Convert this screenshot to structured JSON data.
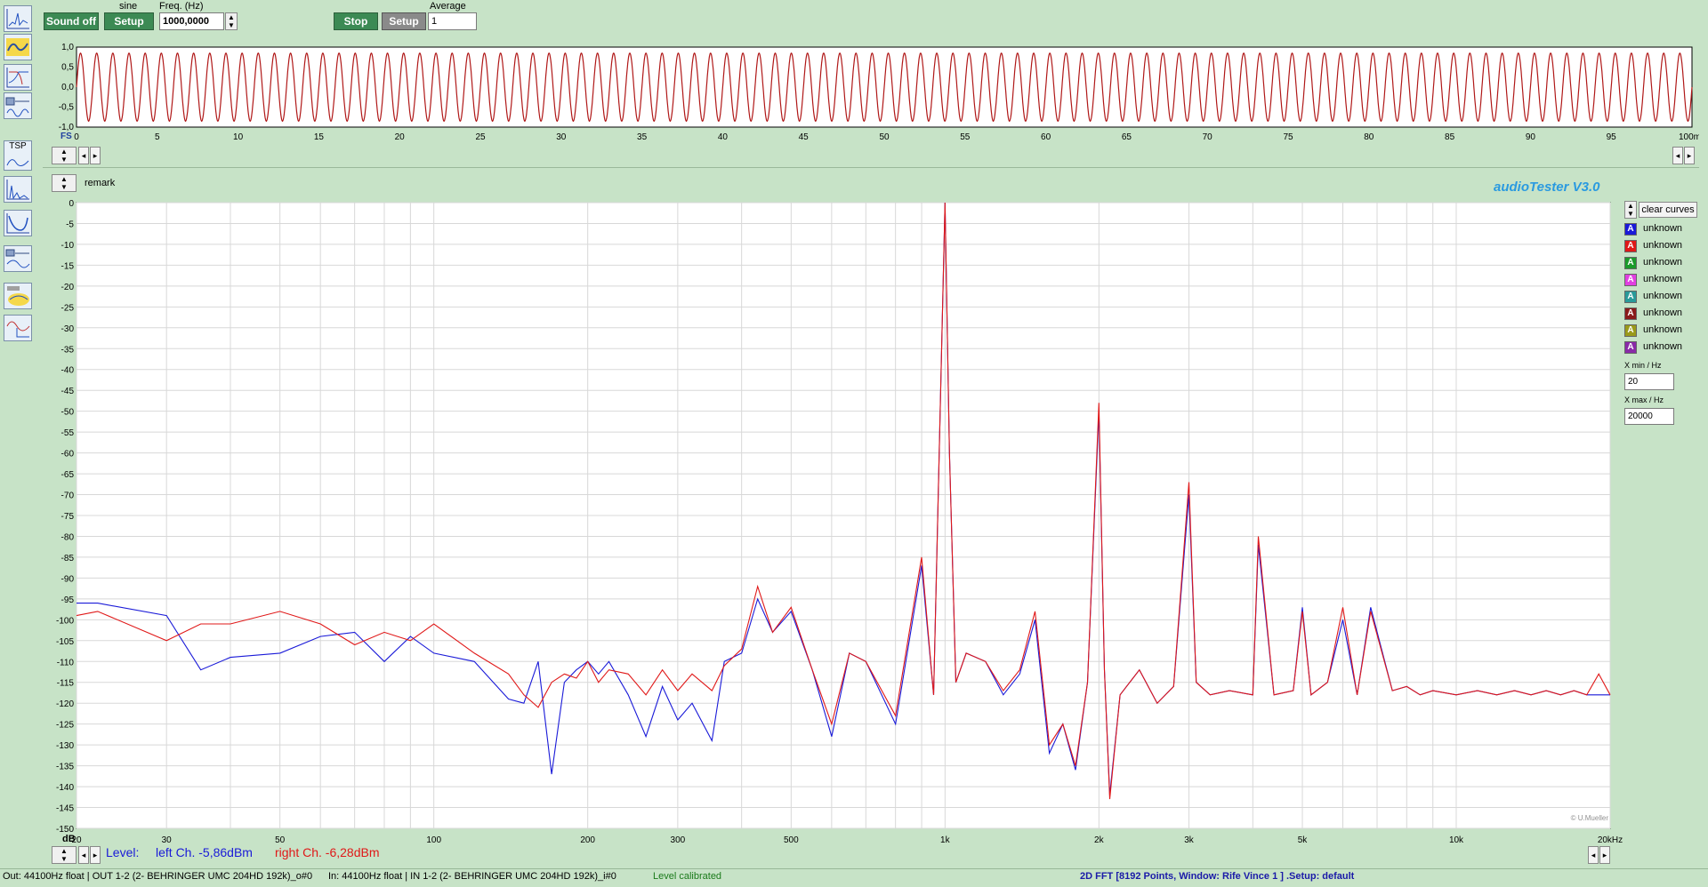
{
  "toolbar": {
    "sound_button": "Sound off",
    "signal_type": "sine",
    "setup_button": "Setup",
    "freq_label": "Freq. (Hz)",
    "freq_value": "1000,0000",
    "stop_button": "Stop",
    "setup2_button": "Setup",
    "average_label": "Average",
    "average_value": "1"
  },
  "sidebar": {
    "tsp_label": "TSP"
  },
  "scope": {
    "y_ticks": [
      "1,0",
      "0,5",
      "0,0",
      "-0,5",
      "-1,0"
    ],
    "fs_label": "FS",
    "x_ticks": [
      "0",
      "5",
      "10",
      "15",
      "20",
      "25",
      "30",
      "35",
      "40",
      "45",
      "50",
      "55",
      "60",
      "65",
      "70",
      "75",
      "80",
      "85",
      "90",
      "95",
      "100ms"
    ],
    "cycles": 100,
    "amplitude": 0.85
  },
  "fft": {
    "remark_label": "remark",
    "app_title": "audioTester  V3.0",
    "copyright": "© U.Mueller",
    "db_label": "dB",
    "y_ticks": [
      "0",
      "-5",
      "-10",
      "-15",
      "-20",
      "-25",
      "-30",
      "-35",
      "-40",
      "-45",
      "-50",
      "-55",
      "-60",
      "-65",
      "-70",
      "-75",
      "-80",
      "-85",
      "-90",
      "-95",
      "-100",
      "-105",
      "-110",
      "-115",
      "-120",
      "-125",
      "-130",
      "-135",
      "-140",
      "-145",
      "-150"
    ],
    "x_ticks": [
      "20",
      "30",
      "50",
      "100",
      "200",
      "300",
      "500",
      "1k",
      "2k",
      "3k",
      "5k",
      "10k",
      "20kHz"
    ],
    "level_label": "Level:",
    "left_level": "left Ch. -5,86dBm",
    "right_level": "right Ch. -6,28dBm",
    "clear_curves": "clear curves",
    "curves": [
      {
        "label": "unknown",
        "color": "#1a1ad8"
      },
      {
        "label": "unknown",
        "color": "#e01818"
      },
      {
        "label": "unknown",
        "color": "#1a9a2a"
      },
      {
        "label": "unknown",
        "color": "#e040e0"
      },
      {
        "label": "unknown",
        "color": "#2a9a9a"
      },
      {
        "label": "unknown",
        "color": "#8a1a1a"
      },
      {
        "label": "unknown",
        "color": "#9a9a1a"
      },
      {
        "label": "unknown",
        "color": "#8a2aa8"
      }
    ],
    "xmin_label": "X min / Hz",
    "xmin_value": "20",
    "xmax_label": "X max / Hz",
    "xmax_value": "20000"
  },
  "chart_data": {
    "type": "line",
    "title": "audioTester  V3.0",
    "xlabel": "",
    "ylabel": "dB",
    "xscale": "log",
    "xlim": [
      20,
      20000
    ],
    "ylim": [
      -150,
      0
    ],
    "grid": true,
    "legend": "right",
    "series": [
      {
        "name": "left Ch. -5,86dBm",
        "color": "#1a1ad8",
        "x": [
          20,
          22,
          30,
          35,
          40,
          50,
          60,
          70,
          80,
          90,
          100,
          120,
          140,
          150,
          160,
          170,
          180,
          190,
          200,
          210,
          220,
          240,
          260,
          280,
          300,
          320,
          350,
          370,
          400,
          430,
          460,
          500,
          550,
          600,
          650,
          700,
          800,
          900,
          950,
          1000,
          1020,
          1050,
          1100,
          1200,
          1300,
          1400,
          1500,
          1600,
          1700,
          1800,
          1900,
          2000,
          2050,
          2100,
          2200,
          2400,
          2600,
          2800,
          3000,
          3100,
          3300,
          3600,
          4000,
          4100,
          4400,
          4800,
          5000,
          5200,
          5600,
          6000,
          6400,
          6800,
          7500,
          8000,
          8500,
          9000,
          10000,
          11000,
          12000,
          13000,
          14000,
          15000,
          16000,
          17000,
          18000,
          19000,
          20000
        ],
        "y": [
          -96,
          -96,
          -99,
          -112,
          -109,
          -108,
          -104,
          -103,
          -110,
          -104,
          -108,
          -110,
          -119,
          -120,
          -110,
          -137,
          -115,
          -112,
          -110,
          -113,
          -110,
          -118,
          -128,
          -116,
          -124,
          -120,
          -129,
          -110,
          -108,
          -95,
          -103,
          -98,
          -112,
          -128,
          -108,
          -110,
          -125,
          -87,
          -118,
          0,
          -60,
          -115,
          -108,
          -110,
          -118,
          -113,
          -100,
          -132,
          -125,
          -136,
          -115,
          -50,
          -112,
          -142,
          -118,
          -112,
          -120,
          -116,
          -70,
          -115,
          -118,
          -117,
          -118,
          -82,
          -118,
          -117,
          -97,
          -118,
          -115,
          -100,
          -118,
          -97,
          -117,
          -116,
          -118,
          -117,
          -118,
          -117,
          -118,
          -117,
          -118,
          -117,
          -118,
          -117,
          -118,
          -118,
          -118
        ]
      },
      {
        "name": "right Ch. -6,28dBm",
        "color": "#e01818",
        "x": [
          20,
          22,
          30,
          35,
          40,
          50,
          60,
          70,
          80,
          90,
          100,
          120,
          140,
          150,
          160,
          170,
          180,
          190,
          200,
          210,
          220,
          240,
          260,
          280,
          300,
          320,
          350,
          370,
          400,
          430,
          460,
          500,
          550,
          600,
          650,
          700,
          800,
          900,
          950,
          1000,
          1020,
          1050,
          1100,
          1200,
          1300,
          1400,
          1500,
          1600,
          1700,
          1800,
          1900,
          2000,
          2050,
          2100,
          2200,
          2400,
          2600,
          2800,
          3000,
          3100,
          3300,
          3600,
          4000,
          4100,
          4400,
          4800,
          5000,
          5200,
          5600,
          6000,
          6400,
          6800,
          7500,
          8000,
          8500,
          9000,
          10000,
          11000,
          12000,
          13000,
          14000,
          15000,
          16000,
          17000,
          18000,
          19000,
          20000
        ],
        "y": [
          -99,
          -98,
          -105,
          -101,
          -101,
          -98,
          -101,
          -106,
          -103,
          -105,
          -101,
          -108,
          -113,
          -118,
          -121,
          -115,
          -113,
          -114,
          -110,
          -115,
          -112,
          -113,
          -118,
          -112,
          -117,
          -113,
          -117,
          -111,
          -107,
          -92,
          -103,
          -97,
          -112,
          -125,
          -108,
          -110,
          -123,
          -85,
          -118,
          0,
          -60,
          -115,
          -108,
          -110,
          -117,
          -112,
          -98,
          -130,
          -125,
          -135,
          -115,
          -48,
          -112,
          -143,
          -118,
          -112,
          -120,
          -116,
          -67,
          -115,
          -118,
          -117,
          -118,
          -80,
          -118,
          -117,
          -98,
          -118,
          -115,
          -97,
          -118,
          -98,
          -117,
          -116,
          -118,
          -117,
          -118,
          -117,
          -118,
          -117,
          -118,
          -117,
          -118,
          -117,
          -118,
          -113,
          -118
        ]
      }
    ]
  },
  "statusbar": {
    "out": "Out: 44100Hz float  | OUT 1-2 (2- BEHRINGER UMC 204HD 192k)_o#0",
    "in": "In: 44100Hz float  | IN 1-2 (2- BEHRINGER UMC 204HD 192k)_i#0",
    "calibrated": "Level calibrated",
    "fft_info": "2D FFT [8192 Points, Window: Rife Vince 1 ]  .Setup:  default"
  }
}
